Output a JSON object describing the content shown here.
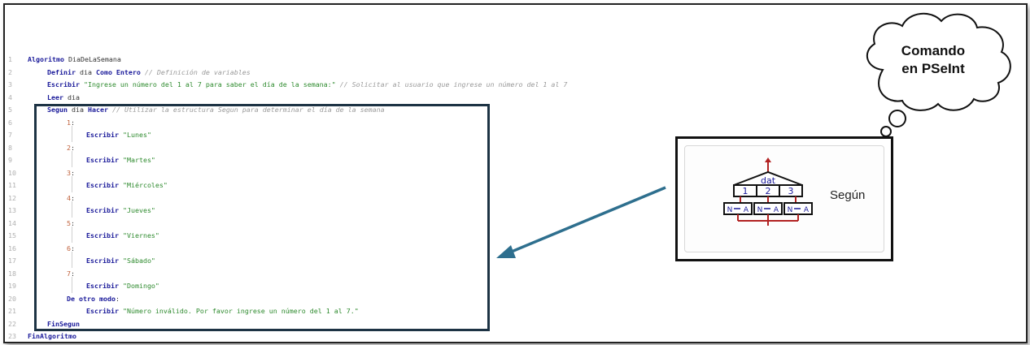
{
  "code": {
    "lines": [
      {
        "n": "1",
        "indent": 0,
        "parts": [
          {
            "t": "kw",
            "v": "Algoritmo"
          },
          {
            "t": "plain",
            "v": " DiaDeLaSemana"
          }
        ]
      },
      {
        "n": "2",
        "indent": 1,
        "parts": [
          {
            "t": "kw",
            "v": "Definir"
          },
          {
            "t": "plain",
            "v": " dia "
          },
          {
            "t": "kw",
            "v": "Como Entero"
          },
          {
            "t": "plain",
            "v": " "
          },
          {
            "t": "cmt",
            "v": "// Definición de variables"
          }
        ]
      },
      {
        "n": "3",
        "indent": 1,
        "parts": [
          {
            "t": "kw",
            "v": "Escribir"
          },
          {
            "t": "plain",
            "v": " "
          },
          {
            "t": "str",
            "v": "\"Ingrese un número del 1 al 7 para saber el día de la semana:\""
          },
          {
            "t": "plain",
            "v": " "
          },
          {
            "t": "cmt",
            "v": "// Solicitar al usuario que ingrese un número del 1 al 7"
          }
        ]
      },
      {
        "n": "4",
        "indent": 1,
        "parts": [
          {
            "t": "kw",
            "v": "Leer"
          },
          {
            "t": "plain",
            "v": " dia"
          }
        ]
      },
      {
        "n": "5",
        "indent": 1,
        "parts": [
          {
            "t": "kw",
            "v": "Segun"
          },
          {
            "t": "plain",
            "v": " dia "
          },
          {
            "t": "kw",
            "v": "Hacer"
          },
          {
            "t": "plain",
            "v": " "
          },
          {
            "t": "cmt",
            "v": "// Utilizar la estructura Segun para determinar el día de la semana"
          }
        ]
      },
      {
        "n": "6",
        "indent": 2,
        "parts": [
          {
            "t": "num",
            "v": "1"
          },
          {
            "t": "plain",
            "v": ":"
          }
        ]
      },
      {
        "n": "7",
        "indent": 3,
        "parts": [
          {
            "t": "kw",
            "v": "Escribir"
          },
          {
            "t": "plain",
            "v": " "
          },
          {
            "t": "str",
            "v": "\"Lunes\""
          }
        ]
      },
      {
        "n": "8",
        "indent": 2,
        "parts": [
          {
            "t": "num",
            "v": "2"
          },
          {
            "t": "plain",
            "v": ":"
          }
        ]
      },
      {
        "n": "9",
        "indent": 3,
        "parts": [
          {
            "t": "kw",
            "v": "Escribir"
          },
          {
            "t": "plain",
            "v": " "
          },
          {
            "t": "str",
            "v": "\"Martes\""
          }
        ]
      },
      {
        "n": "10",
        "indent": 2,
        "parts": [
          {
            "t": "num",
            "v": "3"
          },
          {
            "t": "plain",
            "v": ":"
          }
        ]
      },
      {
        "n": "11",
        "indent": 3,
        "parts": [
          {
            "t": "kw",
            "v": "Escribir"
          },
          {
            "t": "plain",
            "v": " "
          },
          {
            "t": "str",
            "v": "\"Miércoles\""
          }
        ]
      },
      {
        "n": "12",
        "indent": 2,
        "parts": [
          {
            "t": "num",
            "v": "4"
          },
          {
            "t": "plain",
            "v": ":"
          }
        ]
      },
      {
        "n": "13",
        "indent": 3,
        "parts": [
          {
            "t": "kw",
            "v": "Escribir"
          },
          {
            "t": "plain",
            "v": " "
          },
          {
            "t": "str",
            "v": "\"Jueves\""
          }
        ]
      },
      {
        "n": "14",
        "indent": 2,
        "parts": [
          {
            "t": "num",
            "v": "5"
          },
          {
            "t": "plain",
            "v": ":"
          }
        ]
      },
      {
        "n": "15",
        "indent": 3,
        "parts": [
          {
            "t": "kw",
            "v": "Escribir"
          },
          {
            "t": "plain",
            "v": " "
          },
          {
            "t": "str",
            "v": "\"Viernes\""
          }
        ]
      },
      {
        "n": "16",
        "indent": 2,
        "parts": [
          {
            "t": "num",
            "v": "6"
          },
          {
            "t": "plain",
            "v": ":"
          }
        ]
      },
      {
        "n": "17",
        "indent": 3,
        "parts": [
          {
            "t": "kw",
            "v": "Escribir"
          },
          {
            "t": "plain",
            "v": " "
          },
          {
            "t": "str",
            "v": "\"Sábado\""
          }
        ]
      },
      {
        "n": "18",
        "indent": 2,
        "parts": [
          {
            "t": "num",
            "v": "7"
          },
          {
            "t": "plain",
            "v": ":"
          }
        ]
      },
      {
        "n": "19",
        "indent": 3,
        "parts": [
          {
            "t": "kw",
            "v": "Escribir"
          },
          {
            "t": "plain",
            "v": " "
          },
          {
            "t": "str",
            "v": "\"Domingo\""
          }
        ]
      },
      {
        "n": "20",
        "indent": 2,
        "parts": [
          {
            "t": "kw",
            "v": "De otro modo"
          },
          {
            "t": "plain",
            "v": ":"
          }
        ]
      },
      {
        "n": "21",
        "indent": 3,
        "parts": [
          {
            "t": "kw",
            "v": "Escribir"
          },
          {
            "t": "plain",
            "v": " "
          },
          {
            "t": "str",
            "v": "\"Número inválido. Por favor ingrese un número del 1 al 7.\""
          }
        ]
      },
      {
        "n": "22",
        "indent": 1,
        "parts": [
          {
            "t": "kw",
            "v": "FinSegun"
          }
        ]
      },
      {
        "n": "23",
        "indent": 0,
        "parts": [
          {
            "t": "kw",
            "v": "FinAlgoritmo"
          }
        ]
      }
    ]
  },
  "cloud": {
    "line1": "Comando",
    "line2": "en PSeInt"
  },
  "command_panel": {
    "label": "Según",
    "icon": "segun-flowchart-icon",
    "diagram_var": "dat",
    "cases": [
      "1",
      "2",
      "3"
    ],
    "assignments": [
      "N",
      "A"
    ]
  },
  "colors": {
    "keyword": "#1a1a9a",
    "string": "#2d8a2d",
    "comment": "#9a9a9a",
    "number": "#c0603a",
    "arrow": "#2e6f8e",
    "box_border": "#1d3344",
    "diagram_red": "#b22222"
  }
}
